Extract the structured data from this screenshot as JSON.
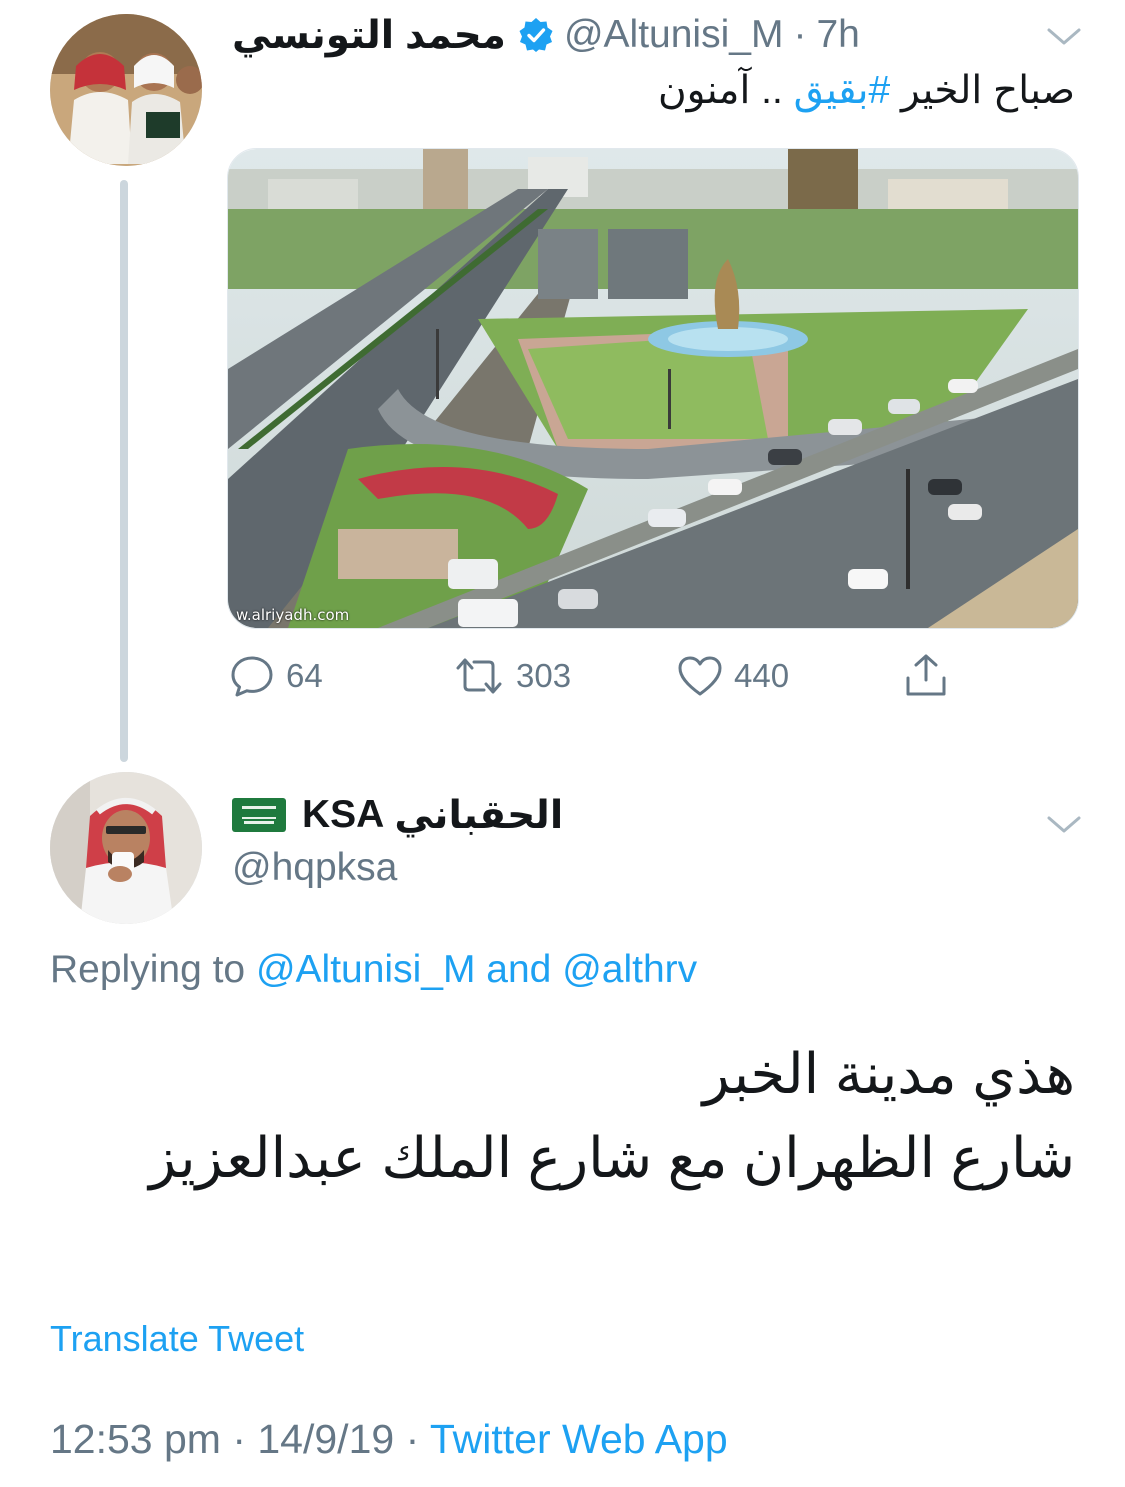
{
  "parent_tweet": {
    "author_name": "محمد التونسي",
    "verified": true,
    "handle": "@Altunisi_M",
    "separator": "·",
    "time": "7h",
    "text_before_hashtag": "صباح الخير ",
    "hashtag": "#بقيق",
    "text_after_hashtag": " .. آمنون",
    "image_watermark": "w.alriyadh.com",
    "stats": {
      "replies": "64",
      "retweets": "303",
      "likes": "440"
    },
    "icons": [
      "reply-icon",
      "retweet-icon",
      "like-icon",
      "share-icon",
      "chevron-down-icon",
      "verified-badge-icon"
    ]
  },
  "reply_tweet": {
    "author_name_en": "KSA",
    "author_name_ar": "الحقباني",
    "flag": "saudi-flag",
    "handle": "@hqpksa",
    "replying_prefix": "Replying to ",
    "replying_to_1": "@Altunisi_M",
    "replying_and": " and ",
    "replying_to_2": "@althrv",
    "text_line1": "هذي مدينة الخبر",
    "text_line2": "شارع الظهران مع شارع الملك عبدالعزيز",
    "translate_label": "Translate Tweet",
    "timestamp": "12:53 pm · 14/9/19 · ",
    "source": "Twitter Web App"
  },
  "colors": {
    "accent": "#1da1f2",
    "secondary_text": "#657786",
    "primary_text": "#14171a",
    "thread_line": "#ccd6dd"
  }
}
